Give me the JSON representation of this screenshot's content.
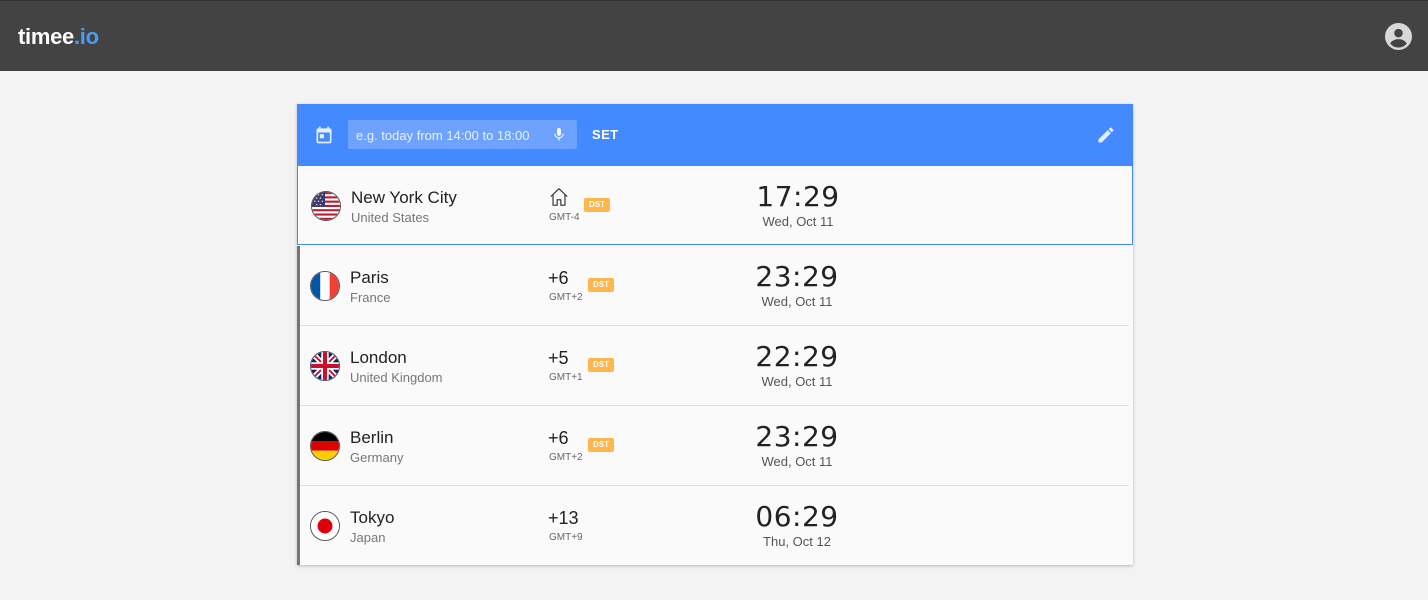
{
  "app": {
    "brand_main": "timee",
    "brand_accent": ".io"
  },
  "header": {
    "account_icon": "account-circle-icon"
  },
  "toolbar": {
    "calendar_icon": "calendar-icon",
    "search_placeholder": "e.g. today from 14:00 to 18:00",
    "search_value": "",
    "mic_icon": "microphone-icon",
    "set_label": "SET",
    "edit_icon": "pencil-icon"
  },
  "colors": {
    "topbar": "#434343",
    "brand_accent": "#4a9cf0",
    "toolbar": "#448aff",
    "dst_badge": "#ffb74d"
  },
  "rows": [
    {
      "city": "New York City",
      "country": "United States",
      "offset": "",
      "home": true,
      "gmt": "GMT-4",
      "dst": "DST",
      "time": "17:29",
      "date": "Wed, Oct 11",
      "flag": "us"
    },
    {
      "city": "Paris",
      "country": "France",
      "offset": "+6",
      "home": false,
      "gmt": "GMT+2",
      "dst": "DST",
      "time": "23:29",
      "date": "Wed, Oct 11",
      "flag": "fr"
    },
    {
      "city": "London",
      "country": "United Kingdom",
      "offset": "+5",
      "home": false,
      "gmt": "GMT+1",
      "dst": "DST",
      "time": "22:29",
      "date": "Wed, Oct 11",
      "flag": "gb"
    },
    {
      "city": "Berlin",
      "country": "Germany",
      "offset": "+6",
      "home": false,
      "gmt": "GMT+2",
      "dst": "DST",
      "time": "23:29",
      "date": "Wed, Oct 11",
      "flag": "de"
    },
    {
      "city": "Tokyo",
      "country": "Japan",
      "offset": "+13",
      "home": false,
      "gmt": "GMT+9",
      "dst": "",
      "time": "06:29",
      "date": "Thu, Oct 12",
      "flag": "jp"
    }
  ]
}
